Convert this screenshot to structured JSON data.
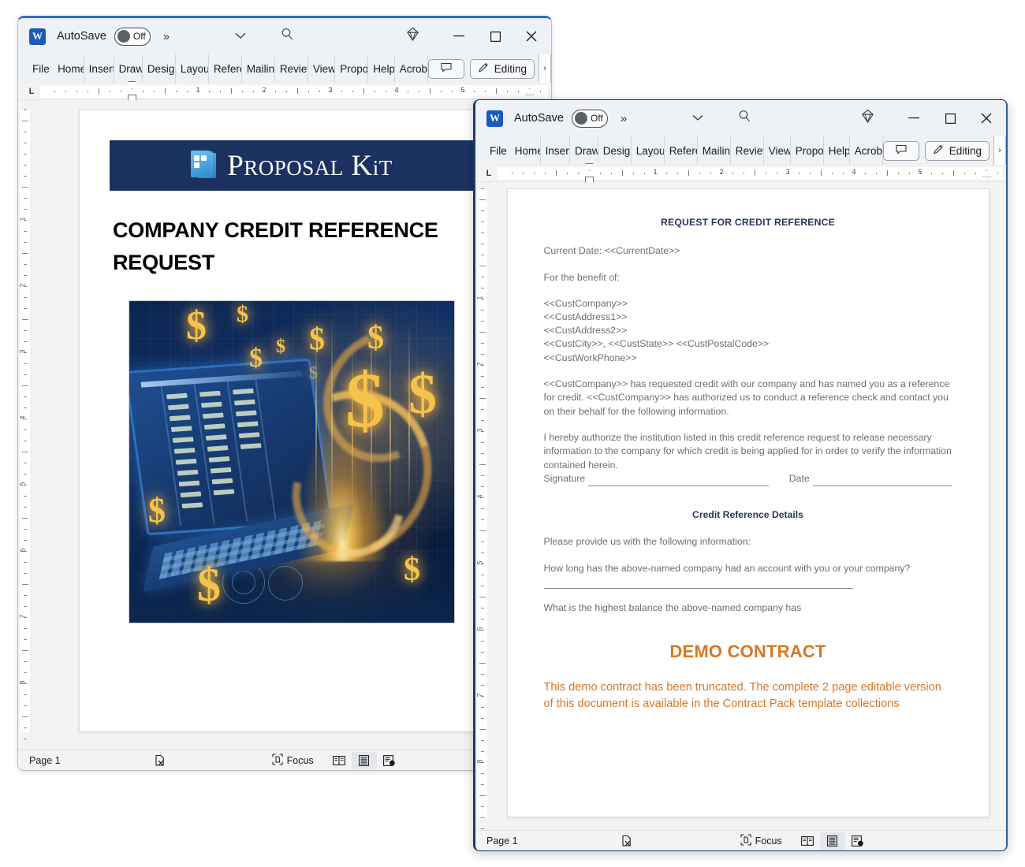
{
  "windows": {
    "back": {
      "titlebar": {
        "app_icon": "word-icon",
        "autosave_label": "AutoSave",
        "autosave_state": "Off",
        "more_commands": "»",
        "customize_icon": "chevron-down-icon",
        "search_icon": "search-icon",
        "copilot_icon": "diamond-copilot-icon",
        "minimize_icon": "minimize-icon",
        "maximize_icon": "maximize-icon",
        "close_icon": "close-icon"
      },
      "ribbon": {
        "tabs": [
          "File",
          "Home",
          "Insert",
          "Draw",
          "Design",
          "Layout",
          "References",
          "Mailings",
          "Review",
          "View",
          "Proposal",
          "Help",
          "Acrobat"
        ],
        "comment_icon": "comment-icon",
        "editing_icon": "pencil-edit-icon",
        "editing_label": "Editing",
        "overflow_icon": "chevron-right-icon"
      },
      "ruler": {
        "tab_selector": "L",
        "numbers": [
          "1",
          "2",
          "3",
          "4",
          "5"
        ],
        "vertical_numbers": [
          "1",
          "2",
          "3",
          "4",
          "5",
          "6",
          "7",
          "8"
        ]
      },
      "document": {
        "banner_logo_name": "proposal-kit-logo",
        "banner_wordmark_a": "P",
        "banner_wordmark_b": "ROPOSAL",
        "banner_wordmark_c": "K",
        "banner_wordmark_d": "i",
        "banner_wordmark_e": "T",
        "title": "COMPANY CREDIT REFERENCE REQUEST",
        "artwork_name": "financial-laptop-dollars-illustration",
        "banner_color": "#1b3260"
      },
      "statusbar": {
        "page": "Page 1",
        "accessibility_icon": "accessibility-checker-icon",
        "focus_icon": "focus-mode-icon",
        "focus_label": "Focus",
        "read_mode_icon": "read-mode-icon",
        "print_layout_icon": "print-layout-icon",
        "web_layout_icon": "web-layout-icon"
      }
    },
    "front": {
      "titlebar": {
        "app_icon": "word-icon",
        "autosave_label": "AutoSave",
        "autosave_state": "Off",
        "more_commands": "»",
        "customize_icon": "chevron-down-icon",
        "search_icon": "search-icon",
        "copilot_icon": "diamond-copilot-icon",
        "minimize_icon": "minimize-icon",
        "maximize_icon": "maximize-icon",
        "close_icon": "close-icon"
      },
      "ribbon": {
        "tabs": [
          "File",
          "Home",
          "Insert",
          "Draw",
          "Design",
          "Layout",
          "References",
          "Mailings",
          "Review",
          "View",
          "Proposal",
          "Help",
          "Acrobat"
        ],
        "comment_icon": "comment-icon",
        "editing_icon": "pencil-edit-icon",
        "editing_label": "Editing",
        "overflow_icon": "chevron-right-icon"
      },
      "ruler": {
        "tab_selector": "L",
        "numbers": [
          "1",
          "2",
          "3",
          "4",
          "5"
        ],
        "vertical_numbers": [
          "1",
          "2",
          "3",
          "4",
          "5",
          "6",
          "7",
          "8"
        ]
      },
      "document": {
        "heading": "REQUEST FOR CREDIT REFERENCE",
        "current_date_line": "Current Date: <<CurrentDate>>",
        "benefit_line": "For the benefit of:",
        "address_lines": [
          "<<CustCompany>>",
          "<<CustAddress1>>",
          "<<CustAddress2>>",
          "<<CustCity>>, <<CustState>> <<CustPostalCode>>",
          "<<CustWorkPhone>>"
        ],
        "paragraph_1": "<<CustCompany>> has requested credit with our company and has named you as a reference for credit. <<CustCompany>> has authorized us to conduct a reference check and contact you on their behalf for the following information.",
        "paragraph_2": "I hereby authorize the institution listed in this credit reference request to release necessary information to the company for which credit is being applied for in order to verify the information contained herein.",
        "signature_label": "Signature",
        "date_label": "Date",
        "section_heading": "Credit Reference Details",
        "please_provide": "Please provide us with the following information:",
        "question_1": "How long has the above-named company had an account with you or your company?",
        "question_2": "What is the highest balance the above-named company has",
        "demo_title": "DEMO CONTRACT",
        "demo_body": "This demo contract has been truncated. The complete 2 page editable version of this document is available in the Contract Pack template collections",
        "heading_color": "#28365c",
        "demo_color": "#d97724"
      },
      "statusbar": {
        "page": "Page 1",
        "accessibility_icon": "accessibility-checker-icon",
        "focus_icon": "focus-mode-icon",
        "focus_label": "Focus",
        "read_mode_icon": "read-mode-icon",
        "print_layout_icon": "print-layout-icon",
        "web_layout_icon": "web-layout-icon"
      }
    }
  }
}
